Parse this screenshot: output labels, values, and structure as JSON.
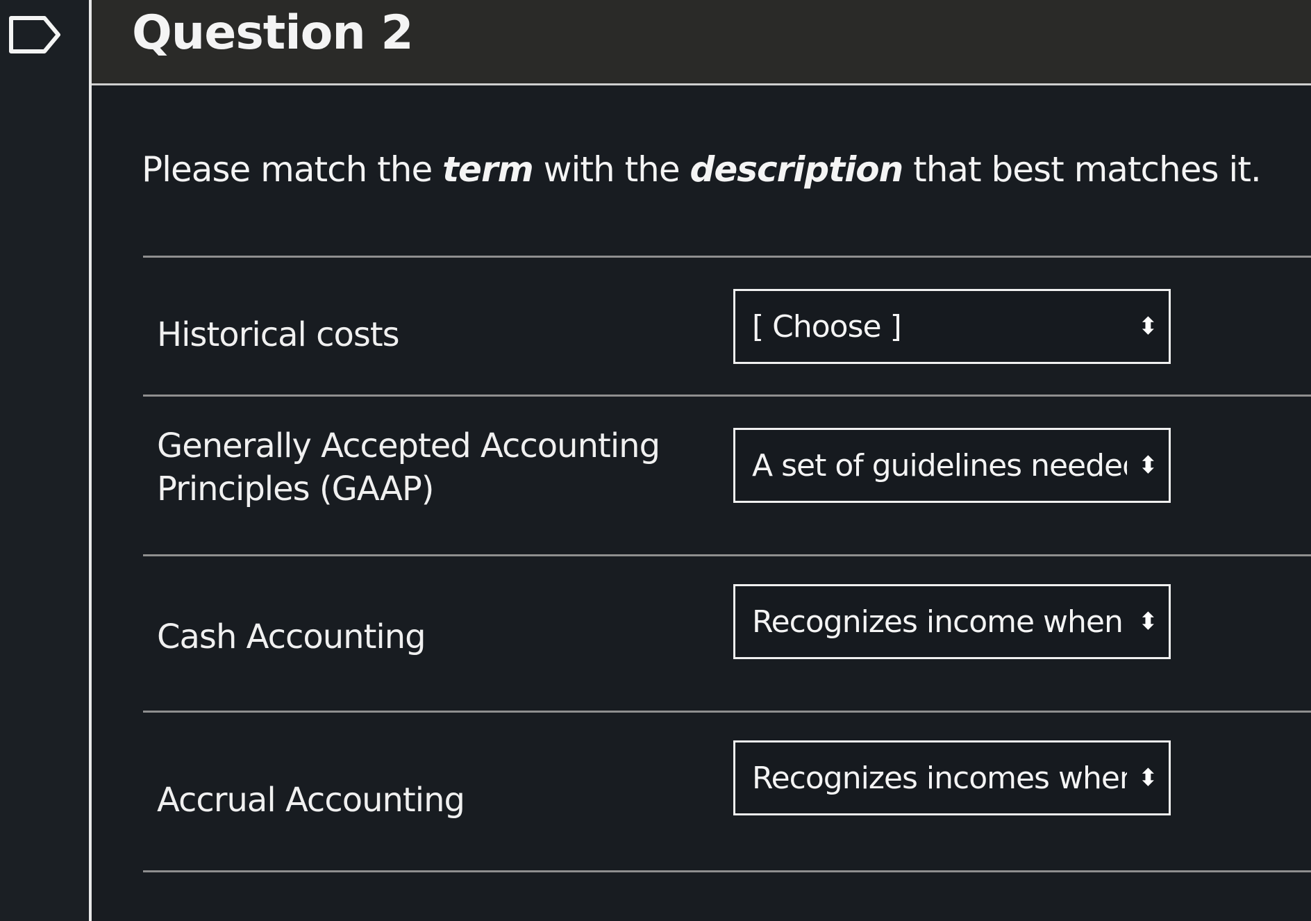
{
  "question": {
    "title": "Question 2",
    "prompt_parts": {
      "p1": "Please match the ",
      "term_word": "term",
      "p2": " with the ",
      "description_word": "description",
      "p3": " that best matches it."
    }
  },
  "pairs": [
    {
      "term": "Historical costs",
      "selected": "[ Choose ]"
    },
    {
      "term": "Generally Accepted Accounting Principles (GAAP)",
      "selected": "A set of guidelines needed for t"
    },
    {
      "term": "Cash Accounting",
      "selected": "Recognizes income when cash i"
    },
    {
      "term": "Accrual Accounting",
      "selected": "Recognizes incomes when a cas"
    }
  ],
  "icons": {
    "flag": "flag-outline-icon",
    "select_arrow": "updown-chevron-icon"
  },
  "colors": {
    "background": "#181c21",
    "header": "#2a2a28",
    "text": "#f4f4f4",
    "border": "#f0f0f0"
  }
}
